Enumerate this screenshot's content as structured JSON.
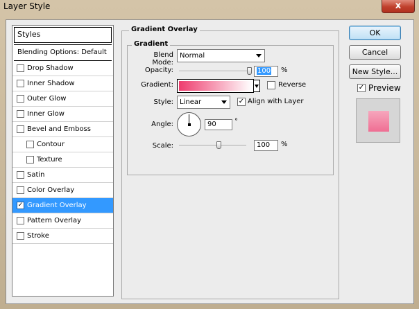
{
  "window": {
    "title": "Layer Style",
    "close_glyph": "x"
  },
  "styles_list": {
    "header": "Styles",
    "blending": "Blending Options: Default",
    "items": [
      {
        "label": "Drop Shadow",
        "checked": false,
        "sub": false
      },
      {
        "label": "Inner Shadow",
        "checked": false,
        "sub": false
      },
      {
        "label": "Outer Glow",
        "checked": false,
        "sub": false
      },
      {
        "label": "Inner Glow",
        "checked": false,
        "sub": false
      },
      {
        "label": "Bevel and Emboss",
        "checked": false,
        "sub": false
      },
      {
        "label": "Contour",
        "checked": false,
        "sub": true
      },
      {
        "label": "Texture",
        "checked": false,
        "sub": true
      },
      {
        "label": "Satin",
        "checked": false,
        "sub": false
      },
      {
        "label": "Color Overlay",
        "checked": false,
        "sub": false
      },
      {
        "label": "Gradient Overlay",
        "checked": true,
        "sub": false,
        "selected": true
      },
      {
        "label": "Pattern Overlay",
        "checked": false,
        "sub": false
      },
      {
        "label": "Stroke",
        "checked": false,
        "sub": false
      }
    ]
  },
  "panel": {
    "group_title": "Gradient Overlay",
    "inner_title": "Gradient",
    "blend_mode_label": "Blend Mode:",
    "blend_mode_value": "Normal",
    "opacity_label": "Opacity:",
    "opacity_value": "100",
    "opacity_level": 1.0,
    "opacity_unit": "%",
    "gradient_label": "Gradient:",
    "gradient_colors": [
      "#ee3d6e",
      "#ffffff"
    ],
    "reverse_label": "Reverse",
    "reverse_checked": false,
    "style_label": "Style:",
    "style_value": "Linear",
    "align_label": "Align with Layer",
    "align_checked": true,
    "angle_label": "Angle:",
    "angle_value": "90",
    "angle_unit": "°",
    "scale_label": "Scale:",
    "scale_value": "100",
    "scale_level": 0.6,
    "scale_unit": "%"
  },
  "buttons": {
    "ok": "OK",
    "cancel": "Cancel",
    "new_style": "New Style...",
    "preview_label": "Preview",
    "preview_checked": true
  },
  "check_glyph": "✓",
  "colors": {
    "selection": "#3399ff",
    "gradient_start": "#ee3d6e",
    "preview": "#ef6e93"
  }
}
